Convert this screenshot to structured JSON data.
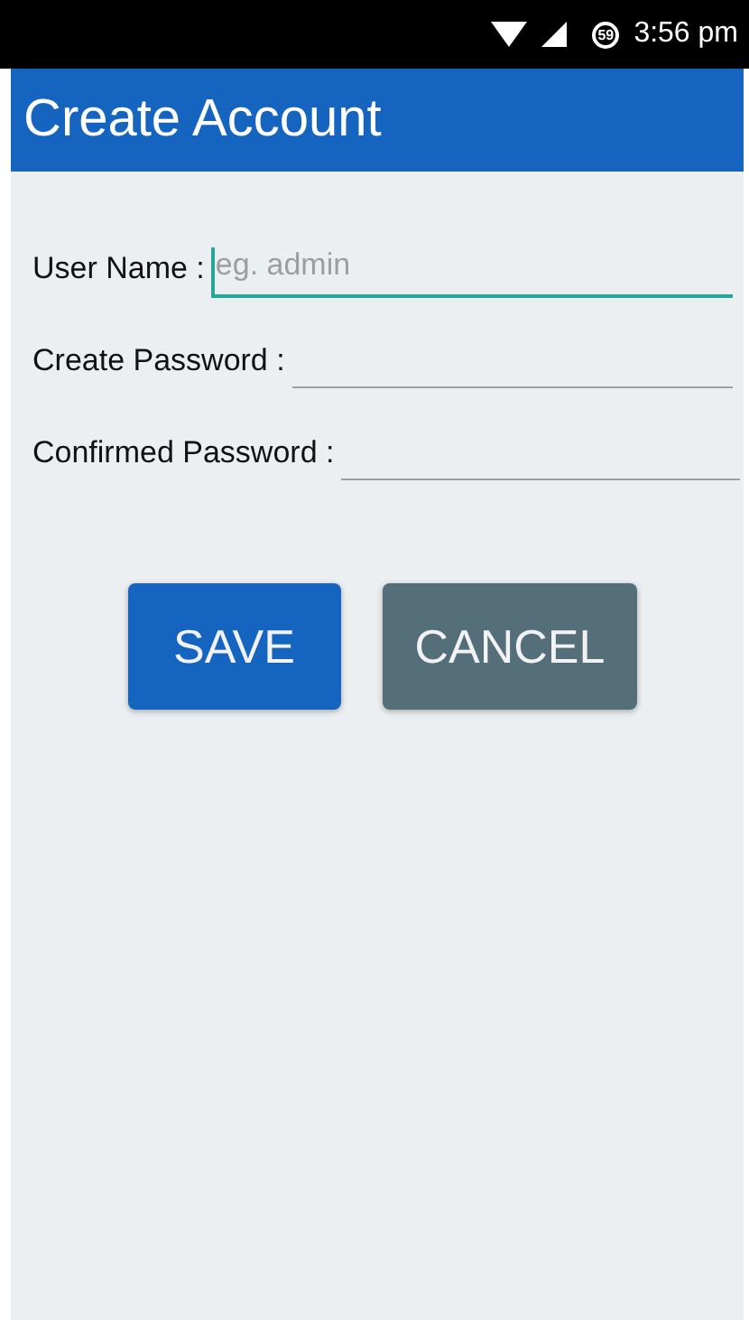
{
  "status_bar": {
    "badge": "59",
    "time": "3:56 pm"
  },
  "toolbar": {
    "title": "Create Account"
  },
  "fields": [
    {
      "label": "User Name :",
      "placeholder": "eg. admin",
      "focused": true
    },
    {
      "label": "Create Password :",
      "focused": false
    },
    {
      "label": "Confirmed Password :",
      "focused": false
    }
  ],
  "buttons": [
    {
      "label": "SAVE",
      "kind": "primary"
    },
    {
      "label": "CANCEL",
      "kind": "secondary"
    }
  ]
}
